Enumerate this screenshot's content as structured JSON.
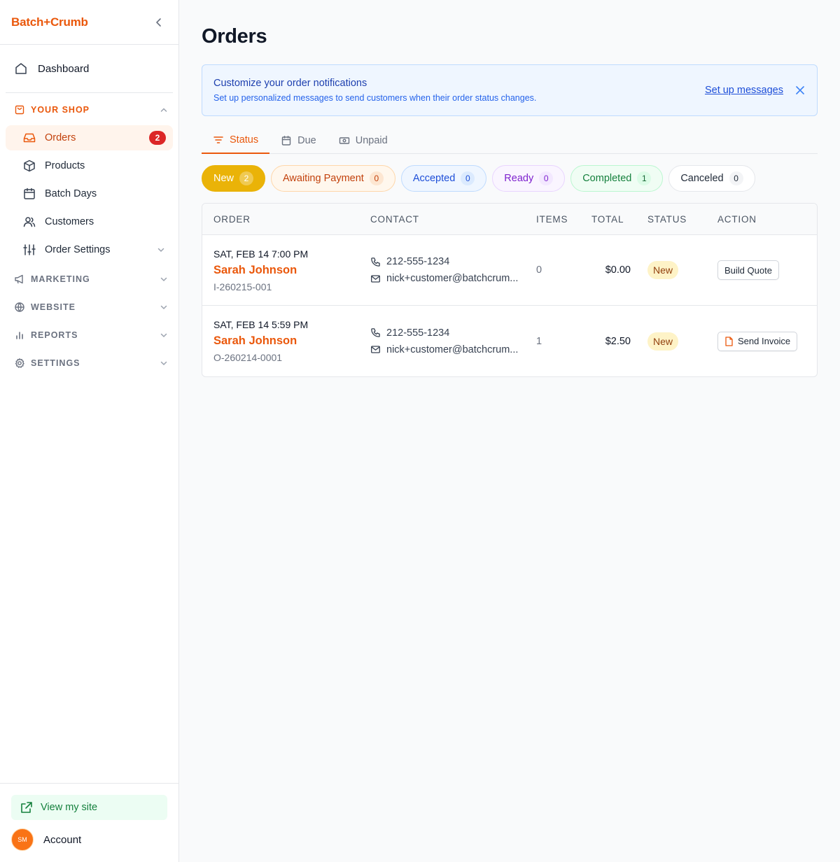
{
  "app": {
    "brand": "Batch+Crumb"
  },
  "sidebar": {
    "dashboard": "Dashboard",
    "your_shop": "YOUR SHOP",
    "shop_items": [
      {
        "label": "Orders",
        "icon": "inbox-icon",
        "badge": "2"
      },
      {
        "label": "Products",
        "icon": "cube-icon"
      },
      {
        "label": "Batch Days",
        "icon": "calendar-icon"
      },
      {
        "label": "Customers",
        "icon": "users-icon"
      },
      {
        "label": "Order Settings",
        "icon": "sliders-icon"
      }
    ],
    "sections": [
      {
        "label": "MARKETING",
        "icon": "megaphone-icon"
      },
      {
        "label": "WEBSITE",
        "icon": "globe-icon"
      },
      {
        "label": "REPORTS",
        "icon": "bar-chart-icon"
      },
      {
        "label": "SETTINGS",
        "icon": "gear-icon"
      }
    ],
    "view_site": "View my site",
    "account": "Account",
    "avatar_initials": "SM"
  },
  "main": {
    "title": "Orders",
    "banner": {
      "title": "Customize your order notifications",
      "subtitle": "Set up personalized messages to send customers when their order status changes.",
      "link": "Set up messages"
    },
    "tabs": [
      "Status",
      "Due",
      "Unpaid"
    ],
    "filters": [
      {
        "label": "New",
        "count": "2"
      },
      {
        "label": "Awaiting Payment",
        "count": "0"
      },
      {
        "label": "Accepted",
        "count": "0"
      },
      {
        "label": "Ready",
        "count": "0"
      },
      {
        "label": "Completed",
        "count": "1"
      },
      {
        "label": "Canceled",
        "count": "0"
      }
    ],
    "table": {
      "headers": [
        "ORDER",
        "CONTACT",
        "ITEMS",
        "TOTAL",
        "STATUS",
        "ACTION"
      ],
      "rows": [
        {
          "date": "SAT, FEB 14 7:00 PM",
          "name": "Sarah Johnson",
          "id": "I-260215-001",
          "phone": "212-555-1234",
          "email": "nick+customer@batchcrum...",
          "items": "0",
          "total": "$0.00",
          "status": "New",
          "action": "Build Quote"
        },
        {
          "date": "SAT, FEB 14 5:59 PM",
          "name": "Sarah Johnson",
          "id": "O-260214-0001",
          "phone": "212-555-1234",
          "email": "nick+customer@batchcrum...",
          "items": "1",
          "total": "$2.50",
          "status": "New",
          "action": "Send Invoice"
        }
      ]
    }
  },
  "colors": {
    "brand": "#ea580c",
    "active_bg": "#fff4ec",
    "badge_red": "#dc2626",
    "new_pill": "#eab308",
    "banner_bg": "#eff6ff"
  }
}
